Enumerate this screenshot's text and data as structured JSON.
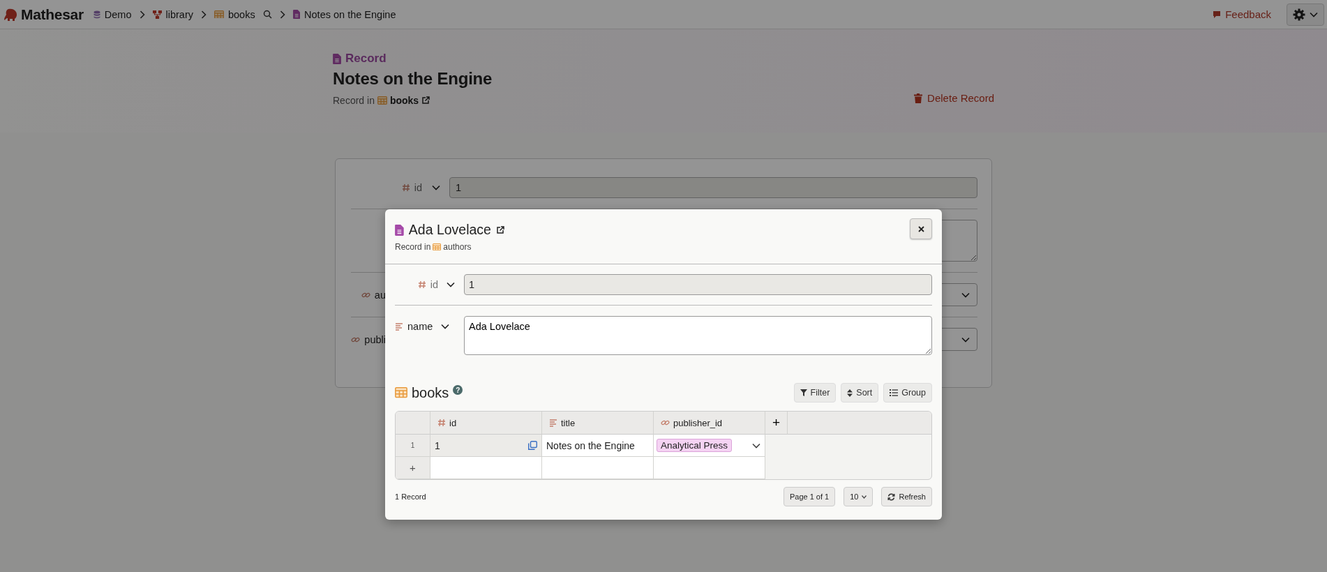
{
  "top_bar": {
    "logo": "Mathesar",
    "breadcrumbs": [
      {
        "kind": "database",
        "label": "Demo"
      },
      {
        "kind": "schema",
        "label": "library"
      },
      {
        "kind": "table",
        "label": "books"
      },
      {
        "kind": "record",
        "label": "Notes on the Engine"
      }
    ],
    "feedback": "Feedback"
  },
  "record_header": {
    "type_label": "Record",
    "title": "Notes on the Engine",
    "record_in": "Record in",
    "table": "books",
    "delete": "Delete Record"
  },
  "record_form": {
    "fields": [
      {
        "kind": "number",
        "label": "id",
        "value": "1",
        "disabled": true
      },
      {
        "kind": "textarea"
      },
      {
        "kind": "link",
        "label": "au"
      },
      {
        "kind": "link",
        "label": "publi"
      }
    ]
  },
  "modal": {
    "title": "Ada Lovelace",
    "record_in": "Record in",
    "table": "authors",
    "fields": [
      {
        "kind": "number",
        "label": "id",
        "value": "1",
        "disabled": true
      },
      {
        "kind": "text",
        "label": "name",
        "value": "Ada Lovelace",
        "disabled": false
      }
    ],
    "related": {
      "title": "books",
      "help": "?",
      "tools": [
        {
          "kind": "filter",
          "label": "Filter"
        },
        {
          "kind": "sort",
          "label": "Sort"
        },
        {
          "kind": "group",
          "label": "Group"
        }
      ],
      "columns": [
        {
          "kind": "number",
          "label": "id"
        },
        {
          "kind": "text",
          "label": "title"
        },
        {
          "kind": "link",
          "label": "publisher_id"
        }
      ],
      "rows": [
        {
          "number": "1",
          "cells": [
            "1",
            "Notes on the Engine",
            "Analytical Press"
          ]
        }
      ],
      "add_column": "+",
      "add_row": "+",
      "count": "1 Record",
      "page": "Page 1 of 1",
      "page_size": "10",
      "refresh": "Refresh"
    }
  }
}
